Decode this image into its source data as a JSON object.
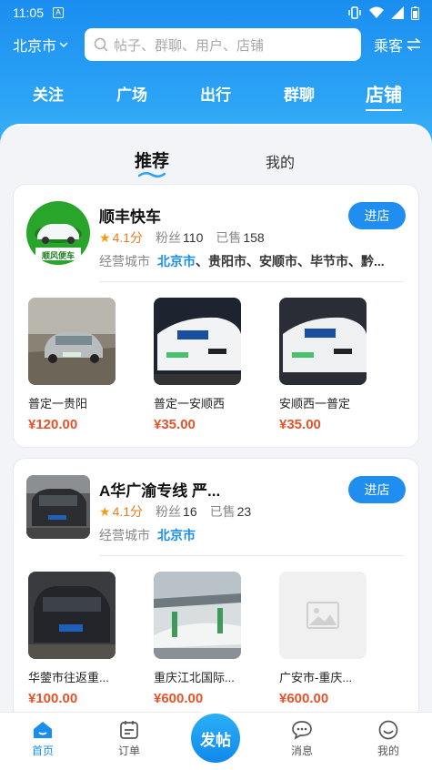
{
  "status_bar": {
    "time": "11:05",
    "sim_label": "A"
  },
  "header": {
    "city": "北京市",
    "search_placeholder": "帖子、群聊、用户、店铺",
    "role": "乘客",
    "nav_tabs": [
      "关注",
      "广场",
      "出行",
      "群聊",
      "店铺"
    ],
    "active_tab": "店铺"
  },
  "sub_tabs": {
    "items": [
      "推荐",
      "我的"
    ],
    "active": "推荐"
  },
  "shops": [
    {
      "name": "顺丰快车",
      "logo_text": "顺风便车",
      "rating": "4.1分",
      "fans_label": "粉丝",
      "fans": "110",
      "sold_label": "已售",
      "sold": "158",
      "city_label": "经营城市",
      "city_primary": "北京市",
      "city_rest": "、贵阳市、安顺市、毕节市、黔...",
      "enter_label": "进店",
      "products": [
        {
          "name": "普定一贵阳",
          "price": "¥120.00"
        },
        {
          "name": "普定一安顺西",
          "price": "¥35.00"
        },
        {
          "name": "安顺西一普定",
          "price": "¥35.00"
        }
      ]
    },
    {
      "name": "A华广渝专线 严...",
      "rating": "4.1分",
      "fans_label": "粉丝",
      "fans": "16",
      "sold_label": "已售",
      "sold": "23",
      "city_label": "经营城市",
      "city_primary": "北京市",
      "city_rest": "",
      "enter_label": "进店",
      "products": [
        {
          "name": "华蓥市往返重...",
          "price": "¥100.00"
        },
        {
          "name": "重庆江北国际...",
          "price": "¥600.00"
        },
        {
          "name": "广安市-重庆...",
          "price": "¥600.00"
        }
      ]
    }
  ],
  "bottom_nav": {
    "home": "首页",
    "orders": "订单",
    "post": "发帖",
    "messages": "消息",
    "mine": "我的"
  },
  "colors": {
    "brand_blue": "#1a8ef0",
    "price_red": "#e4532b",
    "star_orange": "#f39c12"
  }
}
